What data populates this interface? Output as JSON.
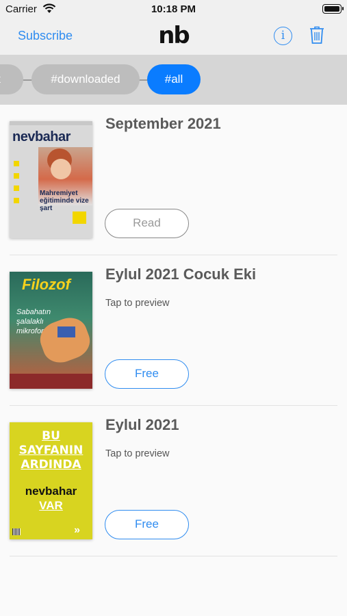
{
  "status_bar": {
    "carrier": "Carrier",
    "time": "10:18 PM"
  },
  "nav": {
    "subscribe_label": "Subscribe",
    "logo": "nb",
    "info_glyph": "i",
    "icons": [
      "info-icon",
      "trash-icon"
    ],
    "accent_color": "#2f8cf0"
  },
  "filters": {
    "chips": [
      {
        "label": "x",
        "active": false
      },
      {
        "label": "#downloaded",
        "active": false
      },
      {
        "label": "#all",
        "active": true
      }
    ],
    "active_color": "#0a7cff"
  },
  "issues": [
    {
      "title": "September 2021",
      "subtitle": "",
      "action": "Read",
      "cover": {
        "masthead": "nevbahar",
        "headline": "Mahremiyet eğitiminde vize şart"
      }
    },
    {
      "title": "Eylul 2021 Cocuk Eki",
      "subtitle": "Tap to preview",
      "action": "Free",
      "cover": {
        "masthead": "Filozof",
        "script": "Sabahatın şalalaklı mikrofonu"
      }
    },
    {
      "title": "Eylul 2021",
      "subtitle": "Tap to preview",
      "action": "Free",
      "cover": {
        "lines": [
          "BU",
          "SAYFANIN",
          "ARDINDA"
        ],
        "brand": "nevbahar",
        "last": "VAR",
        "arrows": "»"
      }
    }
  ]
}
